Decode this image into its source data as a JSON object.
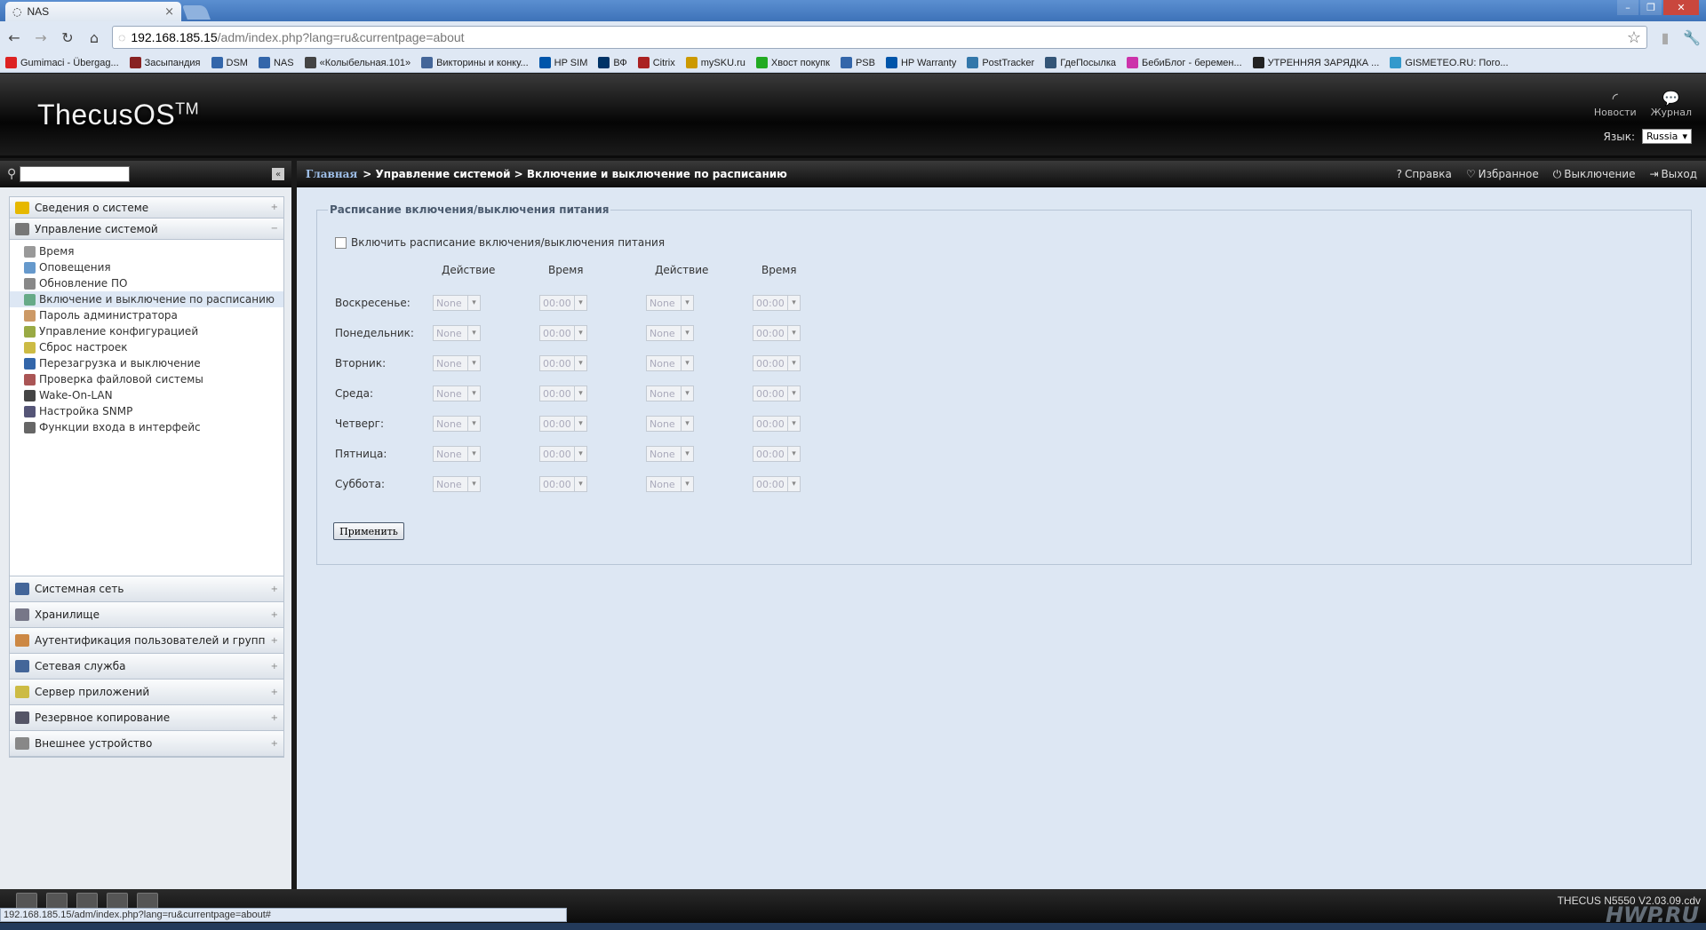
{
  "browser": {
    "tab_title": "NAS",
    "url_host": "192.168.185.15",
    "url_path": "/adm/index.php?lang=ru&currentpage=about",
    "status_url": "192.168.185.15/adm/index.php?lang=ru&currentpage=about#",
    "bookmarks": [
      {
        "label": "Gumimaci - Übergag...",
        "color": "#d22"
      },
      {
        "label": "Засыпандия",
        "color": "#822"
      },
      {
        "label": "DSM",
        "color": "#36a"
      },
      {
        "label": "NAS",
        "color": "#36a"
      },
      {
        "label": "«Колыбельная.101»",
        "color": "#444"
      },
      {
        "label": "Викторины и конку...",
        "color": "#469"
      },
      {
        "label": "HP SIM",
        "color": "#05a"
      },
      {
        "label": "ВФ",
        "color": "#036"
      },
      {
        "label": "Citrix",
        "color": "#a22"
      },
      {
        "label": "mySKU.ru",
        "color": "#c90"
      },
      {
        "label": "Хвост покупк",
        "color": "#2a2"
      },
      {
        "label": "PSB",
        "color": "#36a"
      },
      {
        "label": "HP Warranty",
        "color": "#05a"
      },
      {
        "label": "PostTracker",
        "color": "#37a"
      },
      {
        "label": "ГдеПосылка",
        "color": "#357"
      },
      {
        "label": "БебиБлог - беремен...",
        "color": "#c3a"
      },
      {
        "label": "УТРЕННЯЯ ЗАРЯДКА ...",
        "color": "#222"
      },
      {
        "label": "GISMETEO.RU: Пого...",
        "color": "#39c"
      }
    ]
  },
  "header": {
    "logo": "ThecusOS",
    "logo_tm": "TM",
    "news_label": "Новости",
    "log_label": "Журнал",
    "lang_label": "Язык:",
    "lang_value": "Russia"
  },
  "sidebar": {
    "top_category": {
      "label": "Сведения о системе",
      "toggle": "+"
    },
    "open_category": {
      "label": "Управление системой",
      "toggle": "−"
    },
    "items": [
      {
        "label": "Время",
        "color": "#999"
      },
      {
        "label": "Оповещения",
        "color": "#69c"
      },
      {
        "label": "Обновление ПО",
        "color": "#888"
      },
      {
        "label": "Включение и выключение по расписанию",
        "color": "#6a8"
      },
      {
        "label": "Пароль администратора",
        "color": "#c96"
      },
      {
        "label": "Управление конфигурацией",
        "color": "#9a4"
      },
      {
        "label": "Сброс настроек",
        "color": "#cb4"
      },
      {
        "label": "Перезагрузка и выключение",
        "color": "#36a"
      },
      {
        "label": "Проверка файловой системы",
        "color": "#a55"
      },
      {
        "label": "Wake-On-LAN",
        "color": "#444"
      },
      {
        "label": "Настройка SNMP",
        "color": "#557"
      },
      {
        "label": "Функции входа в интерфейс",
        "color": "#666"
      }
    ],
    "bottom_categories": [
      {
        "label": "Системная сеть",
        "toggle": "+"
      },
      {
        "label": "Хранилище",
        "toggle": "+"
      },
      {
        "label": "Аутентификация пользователей и групп",
        "toggle": "+"
      },
      {
        "label": "Сетевая служба",
        "toggle": "+"
      },
      {
        "label": "Сервер приложений",
        "toggle": "+"
      },
      {
        "label": "Резервное копирование",
        "toggle": "+"
      },
      {
        "label": "Внешнее устройство",
        "toggle": "+"
      }
    ]
  },
  "breadcrumb": {
    "home": "Главная",
    "rest": "> Управление системой > Включение и выключение по расписанию"
  },
  "actions": {
    "help": "Справка",
    "favorites": "Избранное",
    "shutdown": "Выключение",
    "logout": "Выход"
  },
  "schedule": {
    "legend": "Расписание включения/выключения питания",
    "enable_label": "Включить расписание включения/выключения питания",
    "col_action": "Действие",
    "col_time": "Время",
    "days": [
      {
        "name": "Воскресенье:",
        "action1": "None",
        "time1": "00:00",
        "action2": "None",
        "time2": "00:00"
      },
      {
        "name": "Понедельник:",
        "action1": "None",
        "time1": "00:00",
        "action2": "None",
        "time2": "00:00"
      },
      {
        "name": "Вторник:",
        "action1": "None",
        "time1": "00:00",
        "action2": "None",
        "time2": "00:00"
      },
      {
        "name": "Среда:",
        "action1": "None",
        "time1": "00:00",
        "action2": "None",
        "time2": "00:00"
      },
      {
        "name": "Четверг:",
        "action1": "None",
        "time1": "00:00",
        "action2": "None",
        "time2": "00:00"
      },
      {
        "name": "Пятница:",
        "action1": "None",
        "time1": "00:00",
        "action2": "None",
        "time2": "00:00"
      },
      {
        "name": "Суббота:",
        "action1": "None",
        "time1": "00:00",
        "action2": "None",
        "time2": "00:00"
      }
    ],
    "apply_label": "Применить"
  },
  "footer": {
    "model": "THECUS N5550 V2.03.09.cdv",
    "watermark": "HWP.RU"
  }
}
